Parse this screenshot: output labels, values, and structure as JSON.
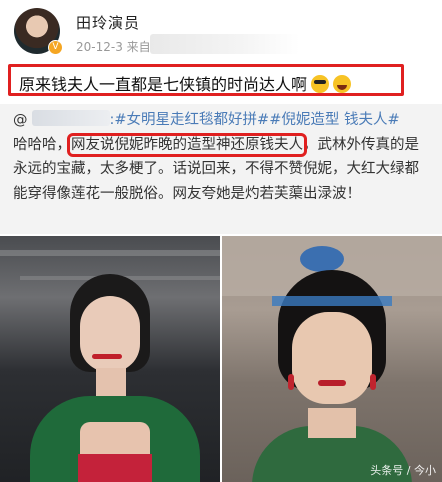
{
  "post": {
    "username": "田玲演员",
    "timestamp": "20-12-3",
    "source_prefix": "来自",
    "headline": "原来钱夫人一直都是七侠镇的时尚达人啊",
    "emoji_1": "sunglasses-emoji",
    "emoji_2": "laughing-emoji"
  },
  "repost": {
    "at": "@",
    "hashtag_1": ":#女明星走红毯都好拼#",
    "hashtag_2": "#倪妮造型",
    "hashtag_3_link": "钱夫人#",
    "prefix": "哈哈哈，",
    "highlight": "网友说倪妮昨晚的造型神还原钱夫人",
    "rest": "，武林外传真的是永远的宝藏，太多梗了。话说回来，不得不赞倪妮，大红大绿都能穿得像莲花一般脱俗。网友夸她是灼若芙蕖出渌波！"
  },
  "images": {
    "watermark": "头条号 / 今小"
  },
  "colors": {
    "highlight_border": "#e02020",
    "hashtag": "#4a7bb7",
    "repost_bg": "#f3f3f3",
    "vip_badge": "#f5a623"
  }
}
